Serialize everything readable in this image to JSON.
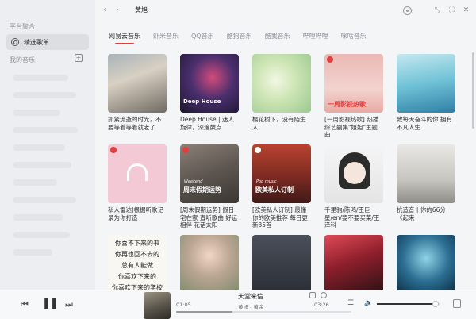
{
  "sidebar": {
    "section_platform": "平台聚合",
    "active_item": "精选歌单",
    "section_my_music": "我的音乐",
    "add_icon": "plus-icon"
  },
  "topbar": {
    "back": "‹",
    "forward": "›",
    "search_value": "黄旭"
  },
  "tabs": [
    "网易云音乐",
    "虾米音乐",
    "QQ音乐",
    "酷狗音乐",
    "酷我音乐",
    "哔哩哔哩",
    "咪咕音乐"
  ],
  "playlists": [
    {
      "title": "抓紧流逝的时光，不要等着等着就老了"
    },
    {
      "title": "Deep House | 迷人旋律，深邃鼓点",
      "cover_label": "Deep House"
    },
    {
      "title": "樱花树下，没有陌生人"
    },
    {
      "title": "[一周影视热歌] 热播综艺剧集\"姐姐\"主题曲",
      "cover_label": "一周影视热歌"
    },
    {
      "title": "致每天奋斗的你 拥有不凡人生"
    },
    {
      "title": "私人雷达|根据听歌记录为你打造"
    },
    {
      "title": "[周末假期运势] 假日宅在家 直听歌曲 好运相伴 花话太阳",
      "cover_label": "周末假期运势",
      "cover_sub": "Weekend"
    },
    {
      "title": "[欧美私人订制] 最懂你的欧美推荐 每日更新35首",
      "cover_label": "欧美私人订制",
      "cover_sub": "Pop music"
    },
    {
      "title": "千里驹/陈鸿/王巨星/en/要不要买菜/王泽科"
    },
    {
      "title": "抗造音 | 你的66分《起来"
    },
    {
      "title": "",
      "poem": [
        "你喜不下来的书",
        "你再也回不去的",
        "总有人能做",
        "你喜欢下来的",
        "你喜欢下来的学校"
      ]
    },
    {
      "title": ""
    },
    {
      "title": ""
    },
    {
      "title": ""
    },
    {
      "title": ""
    }
  ],
  "player": {
    "current_time": "01:05",
    "total_time": "03:26",
    "song_title": "天堂来信",
    "artist": "黄旭 - 黄金",
    "progress": 0.32,
    "volume": 0.92
  },
  "colors": {
    "accent": "#e33e3e"
  }
}
